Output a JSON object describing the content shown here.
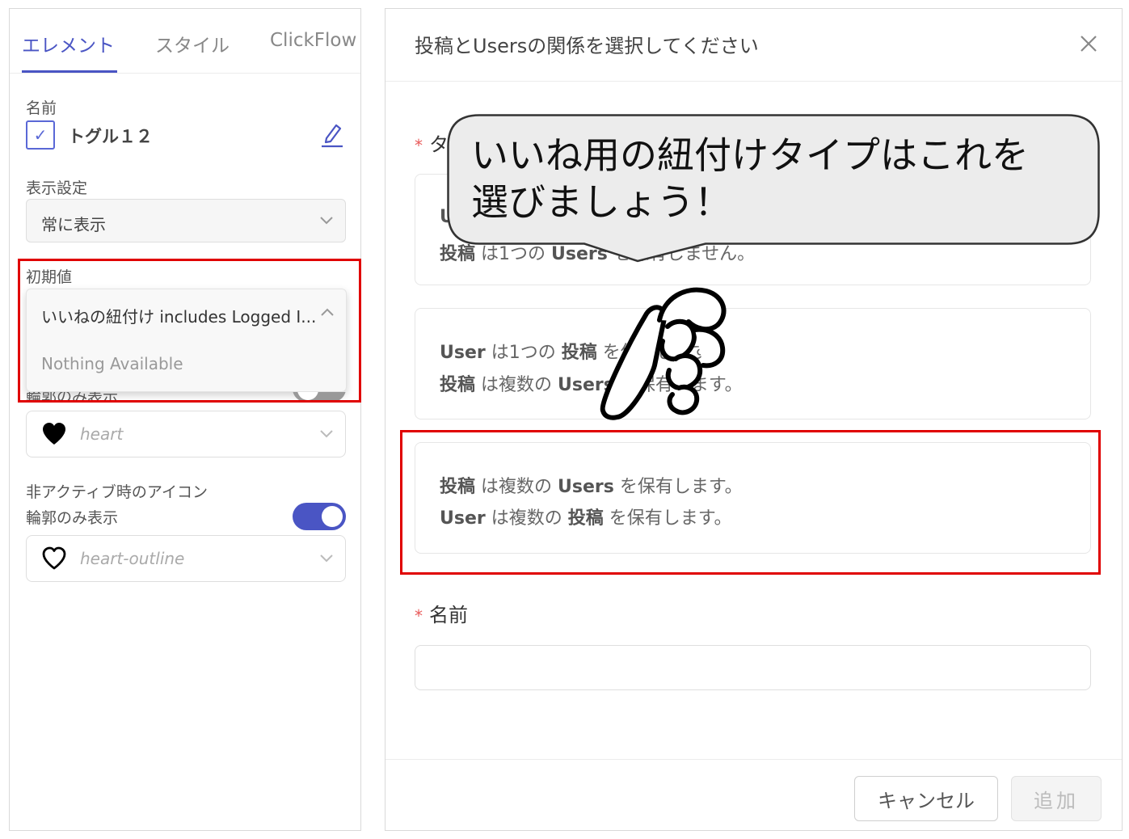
{
  "left": {
    "tabs": [
      {
        "label": "エレメント",
        "active": true
      },
      {
        "label": "スタイル",
        "active": false
      },
      {
        "label": "ClickFlow",
        "active": false
      }
    ],
    "name_label": "名前",
    "element_name": "トグル１２",
    "display_label": "表示設定",
    "display_value": "常に表示",
    "initial_label": "初期値",
    "initial_value": "いいねの紐付け includes Logged I...",
    "nothing_available": "Nothing Available",
    "outline_only_label_cut": "輪郭のみ表示",
    "active_icon_value": "heart",
    "inactive_icon_label": "非アクティブ時のアイコン",
    "inactive_outline_label": "輪郭のみ表示",
    "inactive_icon_value": "heart-outline",
    "toggle_on": true
  },
  "modal": {
    "title": "投稿とUsersの関係を選択してください",
    "type_label_initial": "タ",
    "option1": {
      "line1_prefix": "U",
      "line2": [
        "投稿",
        " は1つの ",
        "Users",
        " を保有しません。"
      ]
    },
    "option2": {
      "line1": [
        "User",
        " は1つの ",
        "投稿",
        " を保有します。"
      ],
      "line2": [
        "投稿",
        " は複数の ",
        "Users",
        " を保有します。"
      ]
    },
    "option3": {
      "line1": [
        "投稿",
        " は複数の ",
        "Users",
        " を保有します。"
      ],
      "line2": [
        "User",
        " は複数の ",
        "投稿",
        " を保有します。"
      ]
    },
    "name_label": "名前",
    "cancel_label": "キャンセル",
    "add_label": "追加"
  },
  "callout": {
    "line1": "いいね用の紐付けタイプはこれを",
    "line2": "選びましょう！"
  },
  "colors": {
    "accent": "#4a55c4",
    "highlight_red": "#e00000",
    "required": "#e85a5a"
  }
}
